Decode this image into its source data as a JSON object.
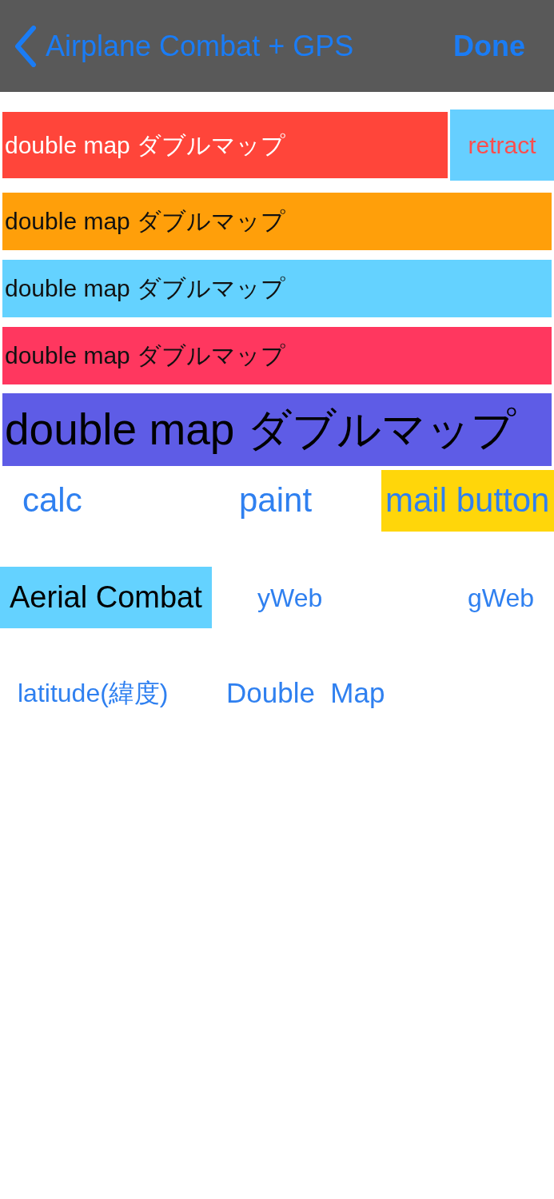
{
  "nav_bar": {
    "back_label": "Airplane Combat + GPS",
    "done_label": "Done"
  },
  "banners": [
    {
      "kind": "swiped",
      "text": "double map ダブルマップ",
      "color": "#ff453a",
      "action": {
        "label": "retract"
      }
    },
    {
      "kind": "normal",
      "text": "double map ダブルマップ",
      "color": "#ff9f0a"
    },
    {
      "kind": "normal",
      "text": "double map ダブルマップ",
      "color": "#64d2ff"
    },
    {
      "kind": "normal",
      "text": "double map ダブルマップ",
      "color": "#ff375f"
    },
    {
      "kind": "large",
      "text": "double map ダブルマップ",
      "color": "#5e5ce6"
    }
  ],
  "button_rows": [
    [
      {
        "kind": "link",
        "label": "calc"
      },
      {
        "kind": "link",
        "label": "paint"
      },
      {
        "kind": "filled",
        "label": "mail button",
        "color": "#ffd60a"
      }
    ],
    [
      {
        "kind": "tile",
        "label": "Aerial Combat",
        "color": "#64d2ff"
      },
      {
        "kind": "link",
        "label": "yWeb"
      },
      {
        "kind": "link",
        "label": "gWeb"
      }
    ],
    [
      {
        "kind": "link",
        "label": "latitude(緯度)"
      },
      {
        "kind": "link",
        "label": "Double  Map"
      }
    ]
  ]
}
